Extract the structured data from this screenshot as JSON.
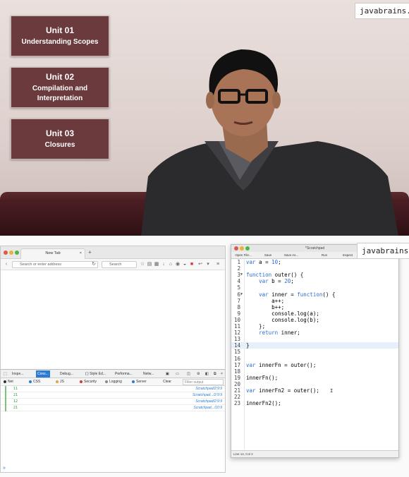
{
  "video": {
    "watermark": "javabrains.io",
    "units": [
      {
        "number": "Unit 01",
        "title": "Understanding Scopes"
      },
      {
        "number": "Unit 02",
        "title": "Compilation and Interpretation"
      },
      {
        "number": "Unit 03",
        "title": "Closures"
      }
    ]
  },
  "screen": {
    "watermark": "javabrains.io",
    "browser": {
      "tab_title": "New Tab",
      "url_placeholder": "Search or enter address",
      "search_placeholder": "Search",
      "devtools": {
        "tabs": [
          "Inspe...",
          "Cons...",
          "Debug...",
          "{ } Style Ed...",
          "Performa...",
          "Netw..."
        ],
        "active_tab": "Cons...",
        "filters": [
          "Net",
          "CSS",
          "JS",
          "Security",
          "Logging",
          "Server"
        ],
        "clear_label": "Clear",
        "filter_placeholder": "Filter output",
        "rows": [
          {
            "value": "11",
            "source": "Scratchpad/2:9:9"
          },
          {
            "value": "21",
            "source": "Scratchpad.../2:9:9"
          },
          {
            "value": "12",
            "source": "Scratchpad/2:9:9"
          },
          {
            "value": "21",
            "source": "Scratchpad.../10:9"
          }
        ],
        "prompt": "»"
      }
    },
    "scratchpad": {
      "title": "*Scratchpad",
      "toolbar": [
        "Open File...",
        "Save",
        "Save As...",
        "Run",
        "Inspect"
      ],
      "status": "Line 14, Col 2",
      "lines": [
        {
          "n": "1",
          "code": "var a = 10;"
        },
        {
          "n": "2",
          "code": ""
        },
        {
          "n": "3",
          "code": "function outer() {"
        },
        {
          "n": "4",
          "code": "    var b = 20;"
        },
        {
          "n": "5",
          "code": ""
        },
        {
          "n": "6",
          "code": "    var inner = function() {"
        },
        {
          "n": "7",
          "code": "        a++;"
        },
        {
          "n": "8",
          "code": "        b++;"
        },
        {
          "n": "9",
          "code": "        console.log(a);"
        },
        {
          "n": "10",
          "code": "        console.log(b);"
        },
        {
          "n": "11",
          "code": "    };"
        },
        {
          "n": "12",
          "code": "    return inner;"
        },
        {
          "n": "13",
          "code": ""
        },
        {
          "n": "14",
          "code": "}"
        },
        {
          "n": "15",
          "code": ""
        },
        {
          "n": "16",
          "code": ""
        },
        {
          "n": "17",
          "code": "var innerFn = outer();"
        },
        {
          "n": "18",
          "code": ""
        },
        {
          "n": "19",
          "code": "innerFn();"
        },
        {
          "n": "20",
          "code": ""
        },
        {
          "n": "21",
          "code": "var innerFn2 = outer();"
        },
        {
          "n": "22",
          "code": ""
        },
        {
          "n": "23",
          "code": "innerFn2();"
        }
      ]
    }
  }
}
